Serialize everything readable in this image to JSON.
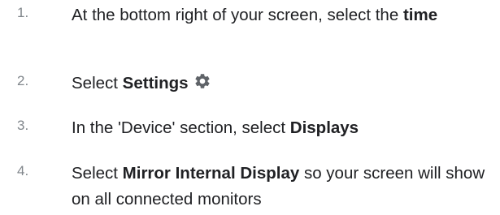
{
  "steps": [
    {
      "number": "1.",
      "parts": [
        {
          "text": "At the bottom right of your screen, select the ",
          "bold": false
        },
        {
          "text": "time",
          "bold": true
        }
      ]
    },
    {
      "number": "2.",
      "parts": [
        {
          "text": "Select ",
          "bold": false
        },
        {
          "text": "Settings",
          "bold": true
        }
      ],
      "icon": "gear-icon"
    },
    {
      "number": "3.",
      "parts": [
        {
          "text": "In the 'Device' section, select ",
          "bold": false
        },
        {
          "text": "Displays",
          "bold": true
        }
      ]
    },
    {
      "number": "4.",
      "parts": [
        {
          "text": "Select ",
          "bold": false
        },
        {
          "text": "Mirror Internal Display",
          "bold": true
        },
        {
          "text": " so your screen will show on all connected monitors",
          "bold": false
        }
      ]
    }
  ],
  "colors": {
    "text": "#202124",
    "number": "#80868b",
    "icon": "#5f6368"
  }
}
